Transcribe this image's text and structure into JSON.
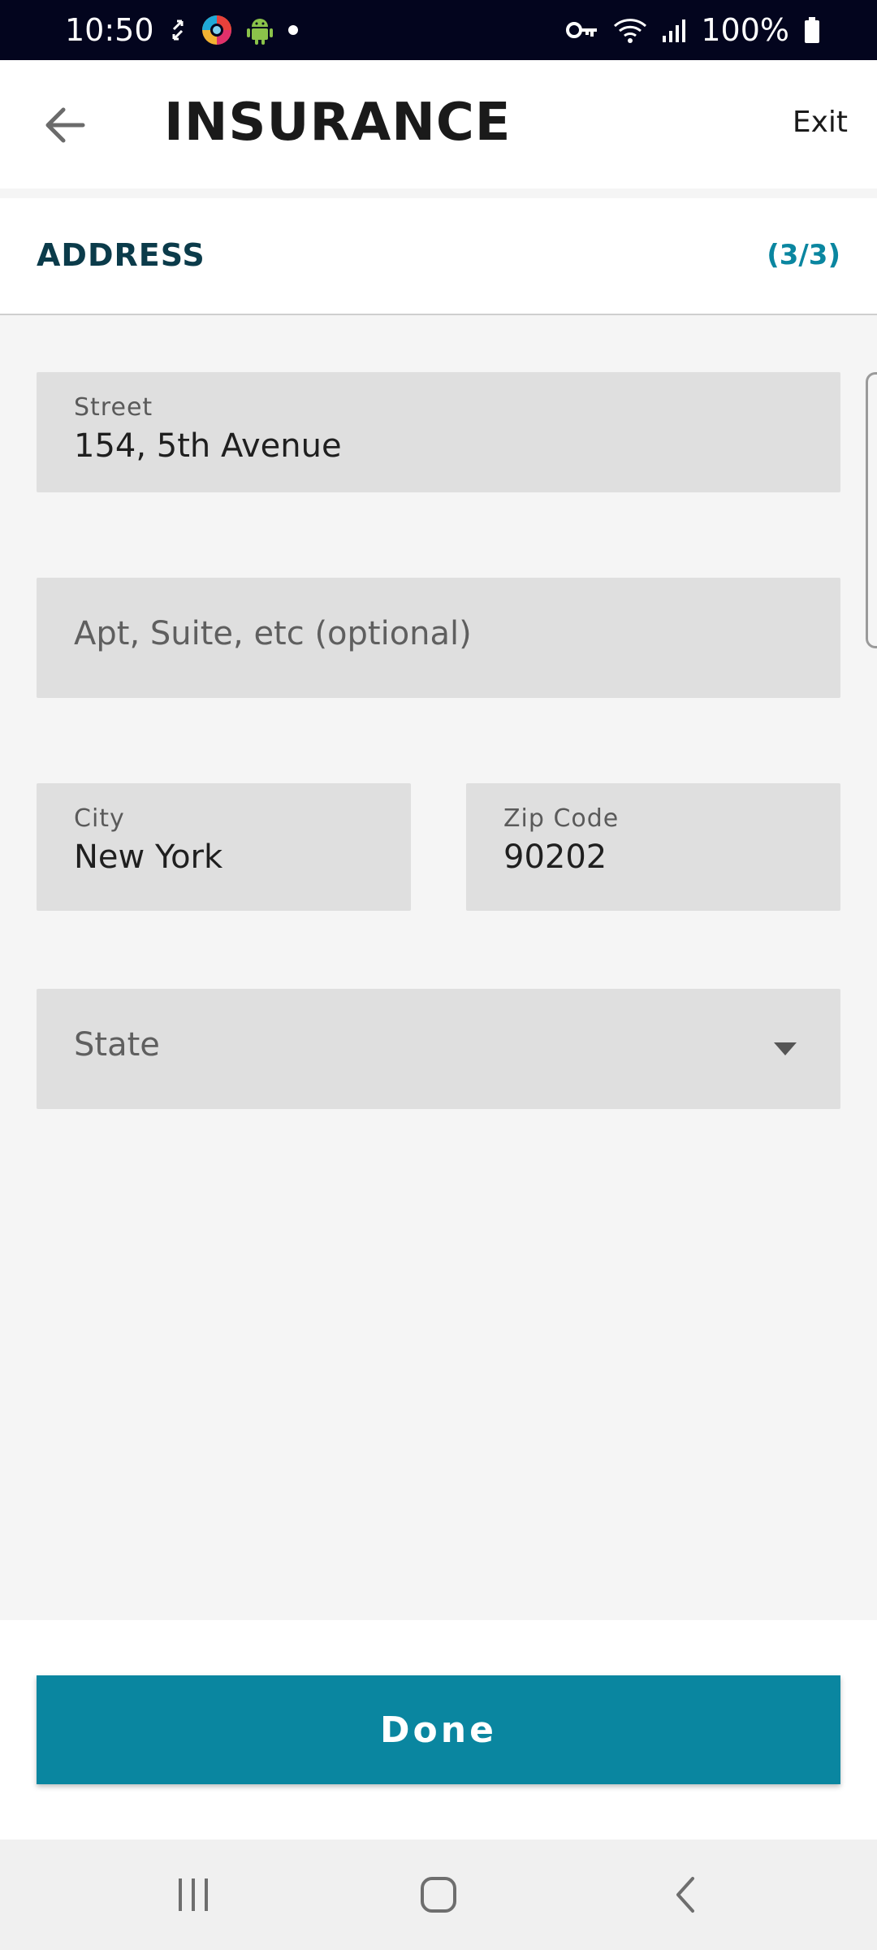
{
  "status_bar": {
    "time": "10:50",
    "battery": "100%",
    "icons": [
      "sync-icon",
      "browser-app-icon",
      "android-icon",
      "dot-icon",
      "vpn-key-icon",
      "wifi-icon",
      "signal-icon",
      "battery-icon"
    ]
  },
  "header": {
    "title": "INSURANCE",
    "exit_label": "Exit",
    "back_icon": "arrow-left-icon"
  },
  "section": {
    "title": "ADDRESS",
    "step": "(3/3)"
  },
  "form": {
    "street": {
      "label": "Street",
      "value": "154, 5th Avenue"
    },
    "apt": {
      "placeholder": "Apt, Suite, etc (optional)"
    },
    "city": {
      "label": "City",
      "value": "New York"
    },
    "zip": {
      "label": "Zip Code",
      "value": "90202"
    },
    "state": {
      "placeholder": "State",
      "icon": "caret-down-icon"
    }
  },
  "actions": {
    "done_label": "Done"
  },
  "nav": {
    "icons": [
      "recent-apps-icon",
      "home-icon",
      "back-icon"
    ]
  },
  "colors": {
    "accent": "#0a86a0",
    "status_bar": "#03051e",
    "section_title": "#0b3b4a",
    "field_bg": "#dfdfdf",
    "page_bg": "#f5f5f5"
  }
}
